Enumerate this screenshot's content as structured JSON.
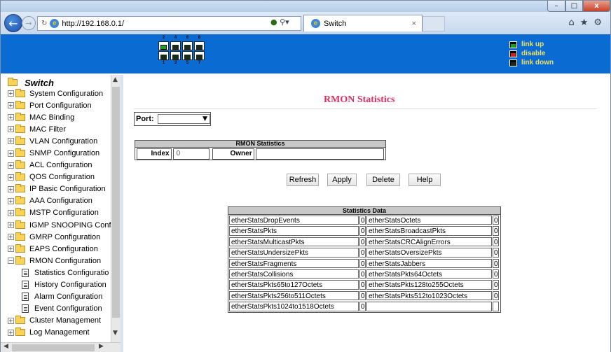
{
  "browser": {
    "url": "http://192.168.0.1/",
    "tab_title": "Switch",
    "tab_close": "×",
    "window_min": "–",
    "window_max": "□",
    "window_close": "x",
    "icons": [
      "home-icon",
      "star-icon",
      "gear-icon"
    ]
  },
  "banner": {
    "port_numbers_top": [
      "2",
      "4",
      "6",
      "8"
    ],
    "port_numbers_bottom": [
      "1",
      "3",
      "5",
      "7"
    ],
    "legend": [
      {
        "label": "link up",
        "color": "#18a018"
      },
      {
        "label": "disable",
        "color": "#d02020"
      },
      {
        "label": "link down",
        "color": "#1a2a1a"
      }
    ]
  },
  "sidebar": {
    "root": "Switch",
    "items": [
      {
        "label": "System Configuration"
      },
      {
        "label": "Port Configuration"
      },
      {
        "label": "MAC Binding"
      },
      {
        "label": "MAC Filter"
      },
      {
        "label": "VLAN Configuration"
      },
      {
        "label": "SNMP Configuration"
      },
      {
        "label": "ACL Configuration"
      },
      {
        "label": "QOS Configuration"
      },
      {
        "label": "IP Basic Configuration"
      },
      {
        "label": "AAA Configuration"
      },
      {
        "label": "MSTP Configuration"
      },
      {
        "label": "IGMP SNOOPING Confi"
      },
      {
        "label": "GMRP Configuration"
      },
      {
        "label": "EAPS Configuration"
      },
      {
        "label": "RMON Configuration"
      }
    ],
    "rmon_children": [
      {
        "label": "Statistics Configuratio"
      },
      {
        "label": "History Configuration"
      },
      {
        "label": "Alarm Configuration"
      },
      {
        "label": "Event Configuration"
      }
    ],
    "items_after": [
      {
        "label": "Cluster Management"
      },
      {
        "label": "Log Management"
      }
    ]
  },
  "main": {
    "title": "RMON Statistics",
    "port_label": "Port:",
    "port_value": "",
    "rmon_header": "RMON Statistics",
    "index_label": "Index",
    "index_value": "0",
    "owner_label": "Owner",
    "owner_value": "",
    "buttons": {
      "refresh": "Refresh",
      "apply": "Apply",
      "delete": "Delete",
      "help": "Help"
    },
    "stats_header": "Statistics Data",
    "stats_rows": [
      {
        "n1": "etherStatsDropEvents",
        "v1": "0",
        "n2": "etherStatsOctets",
        "v2": "0"
      },
      {
        "n1": "etherStatsPkts",
        "v1": "0",
        "n2": "etherStatsBroadcastPkts",
        "v2": "0"
      },
      {
        "n1": "etherStatsMulticastPkts",
        "v1": "0",
        "n2": "etherStatsCRCAlignErrors",
        "v2": "0"
      },
      {
        "n1": "etherStatsUndersizePkts",
        "v1": "0",
        "n2": "etherStatsOversizePkts",
        "v2": "0"
      },
      {
        "n1": "etherStatsFragments",
        "v1": "0",
        "n2": "etherStatsJabbers",
        "v2": "0"
      },
      {
        "n1": "etherStatsCollisions",
        "v1": "0",
        "n2": "etherStatsPkts64Octets",
        "v2": "0"
      },
      {
        "n1": "etherStatsPkts65to127Octets",
        "v1": "0",
        "n2": "etherStatsPkts128to255Octets",
        "v2": "0"
      },
      {
        "n1": "etherStatsPkts256to511Octets",
        "v1": "0",
        "n2": "etherStatsPkts512to1023Octets",
        "v2": "0"
      },
      {
        "n1": "etherStatsPkts1024to1518Octets",
        "v1": "0",
        "n2": "",
        "v2": ""
      }
    ]
  }
}
